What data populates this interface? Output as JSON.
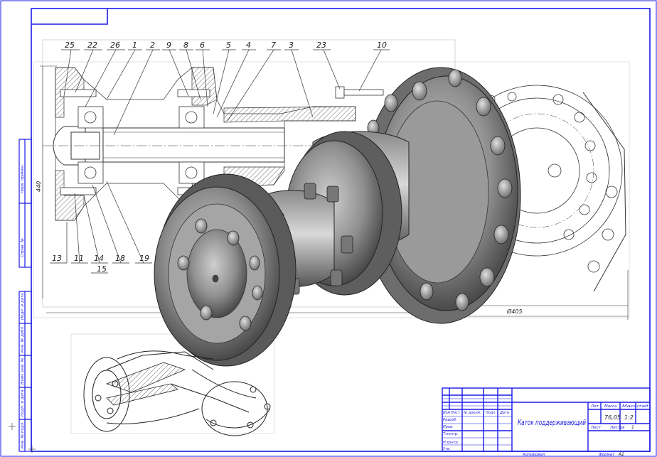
{
  "callouts_top": [
    "25",
    "22",
    "26",
    "1",
    "2",
    "9",
    "8",
    "6",
    "5",
    "4",
    "7",
    "3",
    "23",
    "10"
  ],
  "callouts_bottom": [
    "13",
    "11",
    "14",
    "15",
    "18",
    "19"
  ],
  "dimensions": {
    "height": "440",
    "diameter": "Ø405"
  },
  "side_stamps": [
    "Перв. примен.",
    "Справ. №",
    "Подп. и дата",
    "Инв. № дубл.",
    "Взам. инв. №",
    "Подп. и дата",
    "Инв. № подл."
  ],
  "title_block": {
    "drawing_title": "Каток поддерживающий",
    "col_headers": [
      "Изм",
      "Лист",
      "№ докум.",
      "Подп.",
      "Дата"
    ],
    "row_labels": [
      "Разраб.",
      "Пров.",
      "Т.контр.",
      "",
      "Н.контр.",
      "Утв."
    ],
    "right_headers": [
      "Лит.",
      "Масса",
      "Масштаб"
    ],
    "mass": "76,05",
    "scale": "1:2",
    "sheet_label": "Лист",
    "sheets_label": "Листов",
    "sheets_count": "1",
    "copied": "Копировал",
    "format": "Формат",
    "format_value": "A2"
  }
}
